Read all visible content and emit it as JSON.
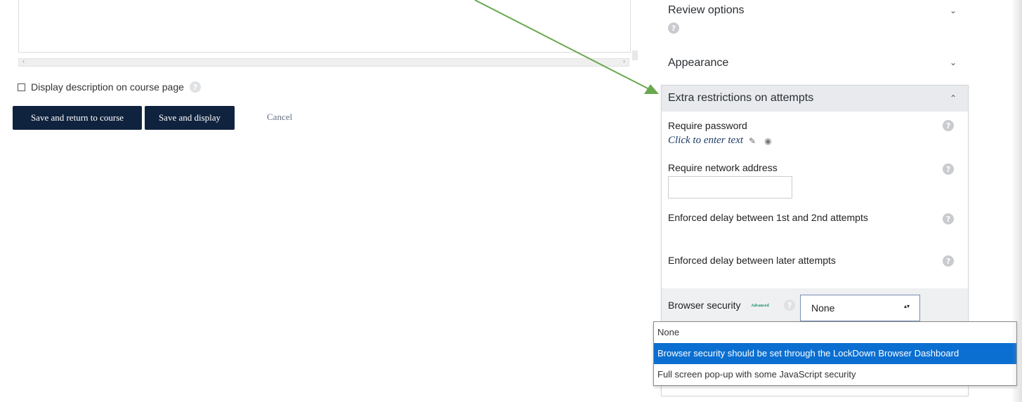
{
  "description": {
    "display_on_course_page_label": "Display description on course page"
  },
  "actions": {
    "save_return_label": "Save and return to course",
    "save_display_label": "Save and display",
    "cancel_label": "Cancel"
  },
  "sections": {
    "review_options": "Review options",
    "appearance": "Appearance",
    "extra_restrictions": "Extra restrictions on attempts"
  },
  "fields": {
    "require_password_label": "Require password",
    "require_password_value": "Click to enter text",
    "require_network_label": "Require network address",
    "require_network_value": "",
    "delay_1_2_label": "Enforced delay between 1st and 2nd attempts",
    "delay_later_label": "Enforced delay between later attempts",
    "browser_security_label": "Browser security",
    "browser_security_badge": "Advanced",
    "browser_security_selected": "None"
  },
  "dropdown": {
    "options": [
      "None",
      "Browser security should be set through the LockDown Browser Dashboard",
      "Full screen pop-up with some JavaScript security"
    ],
    "highlighted_index": 1
  },
  "icons": {
    "help": "question-circle-icon",
    "chevron_down": "chevron-down-icon",
    "chevron_up": "chevron-up-icon",
    "pencil": "pencil-icon",
    "eye": "eye-icon",
    "annotation_arrow": "arrow-annotation"
  },
  "colors": {
    "button_bg": "#10233e",
    "selected_option": "#0a6fd1",
    "annotation_arrow": "#6aa84f"
  }
}
